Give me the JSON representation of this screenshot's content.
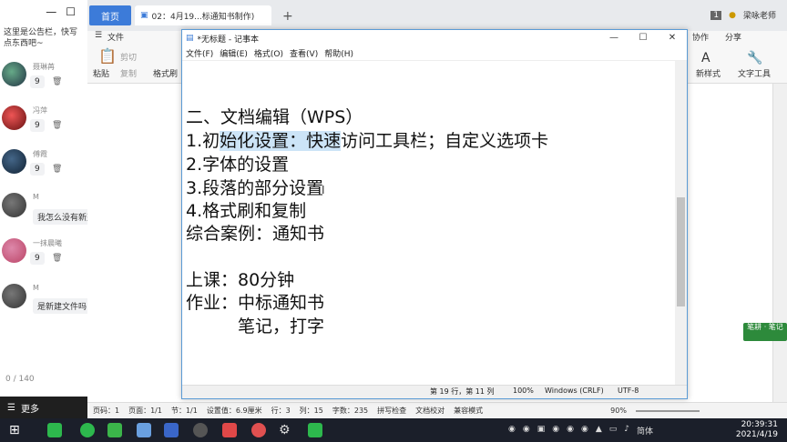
{
  "chat": {
    "notice": "这里是公告栏，快写点东西吧~",
    "messages": [
      {
        "name": "聂琳苒",
        "count": "9"
      },
      {
        "name": "冯萍",
        "count": "9"
      },
      {
        "name": "傅霞",
        "count": "9"
      },
      {
        "name": "M",
        "text": "我怎么没有新建"
      },
      {
        "name": "一抹晨曦",
        "count": "9"
      },
      {
        "name": "M",
        "text": "是新建文件吗"
      }
    ],
    "counter": "0 / 140",
    "more_label": "更多"
  },
  "wps": {
    "tab_home": "首页",
    "tab_doc": "02：4月19...标通知书制作)",
    "user": "梁咏老师",
    "page_badge": "1",
    "ribbon": {
      "file_menu": "文件",
      "paste": "粘贴",
      "cut": "剪切",
      "copy": "复制",
      "format_brush": "格式刷",
      "collab": "协作",
      "share": "分享",
      "new_style": "新样式",
      "text_tools": "文字工具"
    },
    "status": {
      "page": "页码：1",
      "pages": "页面：1/1",
      "section": "节：1/1",
      "setting": "设置值：6.9厘米",
      "row": "行：3",
      "col": "列：15",
      "words": "字数：235",
      "spell": "拼写检查",
      "proof": "文档校对",
      "compat": "兼容模式",
      "zoom": "90%"
    },
    "side_badge": "笔耕 · 笔记"
  },
  "notepad": {
    "title": "*无标题 - 记事本",
    "menu": [
      "文件(F)",
      "编辑(E)",
      "格式(O)",
      "查看(V)",
      "帮助(H)"
    ],
    "lines": [
      "",
      "二、文档编辑（WPS）",
      "1.初始化设置：快速访问工具栏；自定义选项卡",
      "2.字体的设置",
      "3.段落的部分设置",
      "4.格式刷和复制",
      "综合案例：通知书",
      "",
      "上课：80分钟",
      "作业：中标通知书",
      "　　　笔记，打字"
    ],
    "line2_pre": "1.初",
    "line2_sel": "始化设置：快速",
    "line2_post": "访问工具栏；自定义选项卡",
    "status": {
      "pos": "第 19 行，第 11 列",
      "zoom": "100%",
      "eol": "Windows (CRLF)",
      "enc": "UTF-8"
    }
  },
  "taskbar": {
    "time": "20:39:31",
    "date": "2021/4/19",
    "ime": "简体"
  }
}
